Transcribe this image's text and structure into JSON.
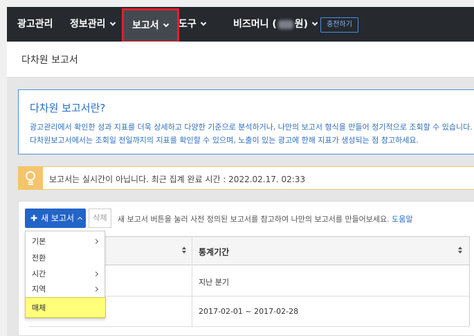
{
  "nav": {
    "items": [
      {
        "label": "광고관리"
      },
      {
        "label": "정보관리"
      },
      {
        "label": "보고서"
      },
      {
        "label": "도구"
      },
      {
        "label_prefix": "비즈머니 (",
        "label_suffix": "원)"
      }
    ],
    "charge_button": "충전하기",
    "active_item": "보고서",
    "highlight_color": "#e2202d"
  },
  "page": {
    "title": "다차원 보고서"
  },
  "info_box": {
    "title": "다차원 보고서란?",
    "line1": "광고관리에서 확인한 성과 지표를 더욱 상세하고 다양한 기준으로 분석하거나, 나만의 보고서 형식을 만들어 정기적으로 조회할 수 있습니다.",
    "line2": "다차원보고서에서는 조회일 전일까지의 지표를 확인할 수 있으며, 노출이 있는 광고에 한해 지표가 생성되는 점 참고하세요."
  },
  "notice": {
    "text": "보고서는 실시간이 아닙니다. 최근 집계 완료 시간 : 2022.02.17. 02:33",
    "icon": "lightbulb-icon"
  },
  "toolbar": {
    "new_report": "새 보고서",
    "delete": "삭제",
    "help_text": "새 보고서 버튼을 눌러 사전 정의된 보고서를 참고하여 나만의 보고서를 만들어보세요.",
    "help_link": "도움말"
  },
  "table": {
    "headers": [
      "",
      "통계기간"
    ],
    "rows": [
      {
        "period": "지난 분기"
      },
      {
        "period": "2017-02-01 ~ 2017-02-28"
      }
    ]
  },
  "dropdown": {
    "items": [
      {
        "label": "기본",
        "has_submenu": true
      },
      {
        "label": "전환",
        "has_submenu": false
      },
      {
        "label": "시간",
        "has_submenu": true
      },
      {
        "label": "지역",
        "has_submenu": true
      },
      {
        "label": "매체",
        "has_submenu": false,
        "highlighted": true
      }
    ],
    "highlight_color": "#ffff7a"
  }
}
